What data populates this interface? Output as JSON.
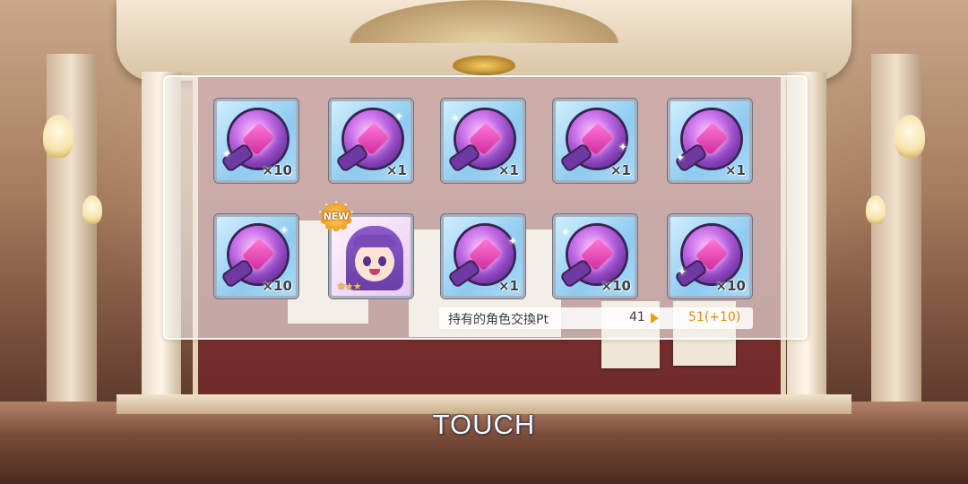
{
  "items": [
    {
      "type": "gem",
      "quantity": "×10"
    },
    {
      "type": "gem",
      "quantity": "×1"
    },
    {
      "type": "gem",
      "quantity": "×1"
    },
    {
      "type": "gem",
      "quantity": "×1"
    },
    {
      "type": "gem",
      "quantity": "×1"
    },
    {
      "type": "gem",
      "quantity": "×10"
    },
    {
      "type": "character",
      "rarity_stars": "★★★",
      "badge": "NEW"
    },
    {
      "type": "gem",
      "quantity": "×1"
    },
    {
      "type": "gem",
      "quantity": "×10"
    },
    {
      "type": "gem",
      "quantity": "×10"
    }
  ],
  "points": {
    "label": "持有的角色交換Pt",
    "current": "41",
    "after": "51(+10)"
  },
  "prompt": "TOUCH",
  "colors": {
    "accent": "#f39a12",
    "gem": "#c76ee8",
    "cell_bg": "#a9d9f6"
  }
}
